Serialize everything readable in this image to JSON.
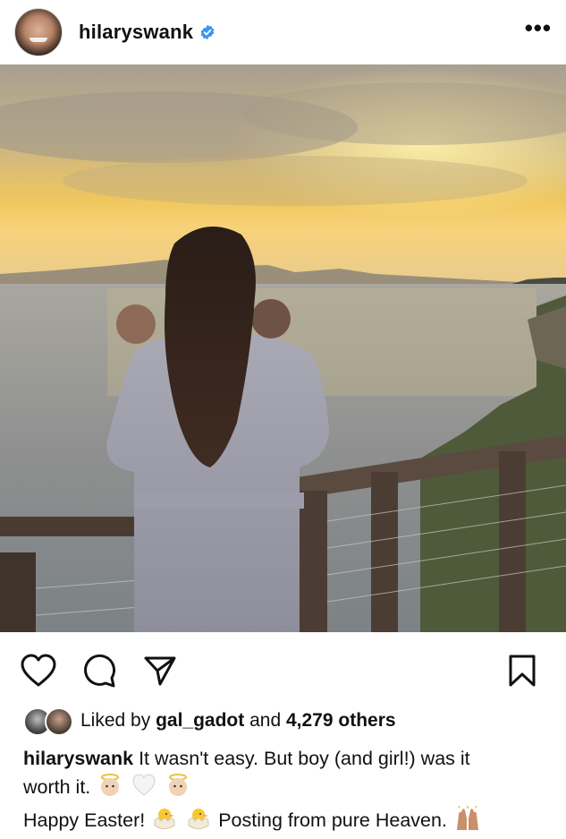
{
  "post": {
    "username": "hilaryswank",
    "more_label": "•••"
  },
  "actions": {
    "like_icon": "heart-icon",
    "comment_icon": "comment-icon",
    "share_icon": "paper-plane-icon",
    "save_icon": "bookmark-icon"
  },
  "likes": {
    "prefix": "Liked by",
    "liker": "gal_gadot",
    "middle": "and",
    "others": "4,279 others"
  },
  "caption": {
    "username": "hilaryswank",
    "line1": "It wasn't easy. But boy (and girl!) was it",
    "line2_text": "worth it.",
    "line3_start": "Happy Easter!",
    "line3_end": "Posting from pure Heaven."
  },
  "colors": {
    "verified": "#3897f0",
    "text": "#111111"
  }
}
